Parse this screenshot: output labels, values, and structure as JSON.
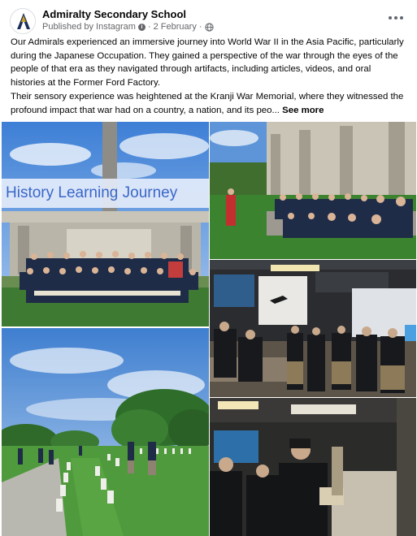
{
  "post": {
    "page_name": "Admiralty Secondary School",
    "published_by": "Published by Instagram",
    "date": "2 February",
    "paragraph1": "Our Admirals experienced an immersive journey into World War II in the Asia Pacific, particularly during the Japanese Occupation. They gained a perspective of the war through the eyes of the people of that era as they navigated through artifacts, including articles, videos, and oral histories at the Former Ford Factory.",
    "paragraph2": "Their sensory experience was heightened at the Kranji War Memorial, where they witnessed the profound impact that war had on a country, a nation, and its peo...",
    "see_more": "See more"
  },
  "photos": {
    "banner_text": "History Learning Journey"
  },
  "icons": [
    "school-logo-icon",
    "info-icon",
    "globe-icon",
    "more-options-icon"
  ],
  "colors": {
    "text": "#050505",
    "secondary": "#65676b",
    "banner_text": "#3a67c9"
  }
}
